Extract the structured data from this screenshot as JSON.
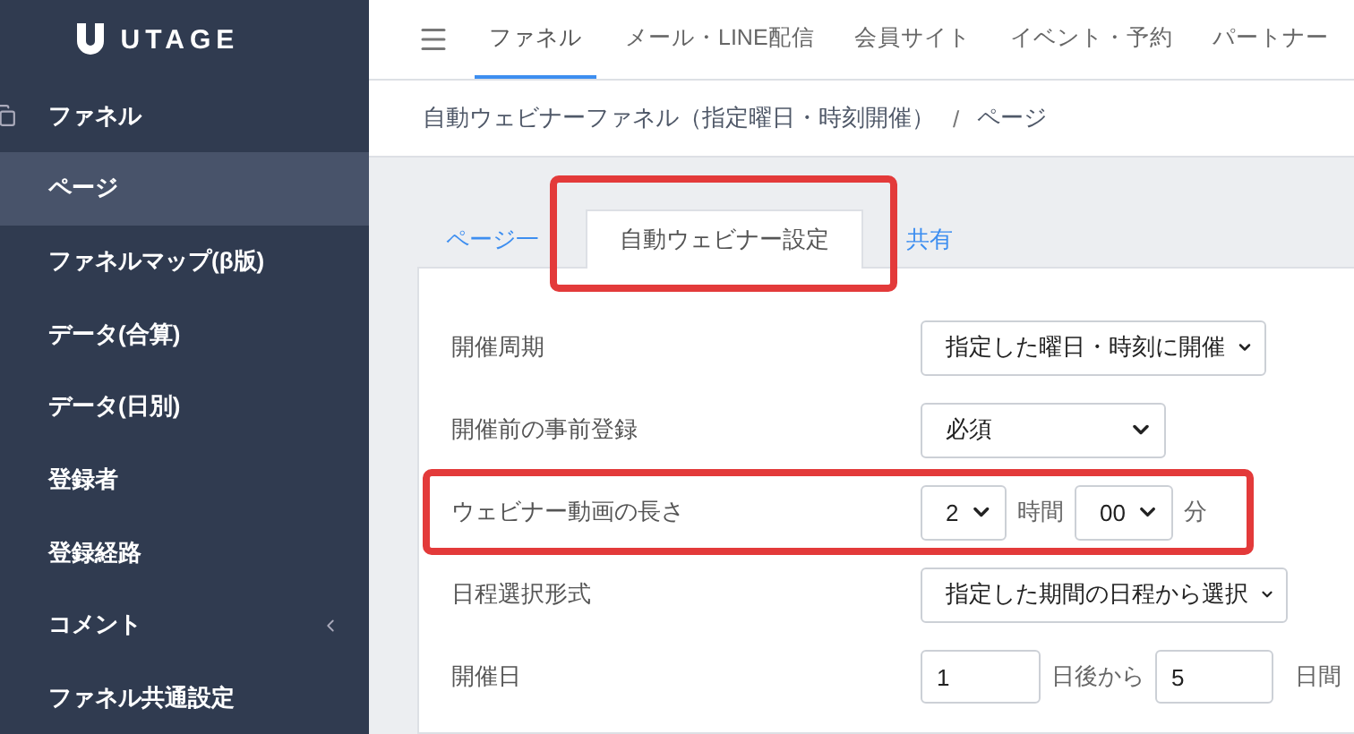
{
  "logo": {
    "text": "UTAGE"
  },
  "sidebar": {
    "items": [
      {
        "label": "ファネル",
        "kind": "section",
        "selected": false
      },
      {
        "label": "ページ",
        "kind": "link",
        "selected": true
      },
      {
        "label": "ファネルマップ(β版)",
        "kind": "link",
        "selected": false
      },
      {
        "label": "データ(合算)",
        "kind": "link",
        "selected": false
      },
      {
        "label": "データ(日別)",
        "kind": "link",
        "selected": false
      },
      {
        "label": "登録者",
        "kind": "link",
        "selected": false
      },
      {
        "label": "登録経路",
        "kind": "link",
        "selected": false
      },
      {
        "label": "コメント",
        "kind": "submenu",
        "selected": false
      },
      {
        "label": "ファネル共通設定",
        "kind": "link",
        "selected": false
      }
    ]
  },
  "top_nav": {
    "items": [
      {
        "label": "ファネル",
        "selected": true
      },
      {
        "label": "メール・LINE配信",
        "selected": false
      },
      {
        "label": "会員サイト",
        "selected": false
      },
      {
        "label": "イベント・予約",
        "selected": false
      },
      {
        "label": "パートナー",
        "selected": false
      }
    ]
  },
  "breadcrumb": {
    "items": [
      "自動ウェビナーファネル（指定曜日・時刻開催）",
      "ページ"
    ],
    "separator": "/"
  },
  "tabs": [
    {
      "label": "ページ一",
      "selected": false,
      "highlighted": false
    },
    {
      "label": "自動ウェビナー設定",
      "selected": true,
      "highlighted": true
    },
    {
      "label": "共有",
      "selected": false,
      "highlighted": false
    }
  ],
  "form": {
    "rows": [
      {
        "label": "開催周期",
        "kind": "select",
        "value": "指定した曜日・時刻に開催",
        "highlighted": false
      },
      {
        "label": "開催前の事前登録",
        "kind": "select",
        "value": "必須",
        "highlighted": false
      },
      {
        "label": "ウェビナー動画の長さ",
        "kind": "duration",
        "hours": "2",
        "hours_unit": "時間",
        "minutes": "00",
        "minutes_unit": "分",
        "highlighted": true
      },
      {
        "label": "日程選択形式",
        "kind": "select",
        "value": "指定した期間の日程から選択",
        "highlighted": false
      },
      {
        "label": "開催日",
        "kind": "range",
        "from": "1",
        "from_unit": "日後から",
        "to": "5",
        "to_unit": "日間",
        "highlighted": false
      }
    ]
  }
}
